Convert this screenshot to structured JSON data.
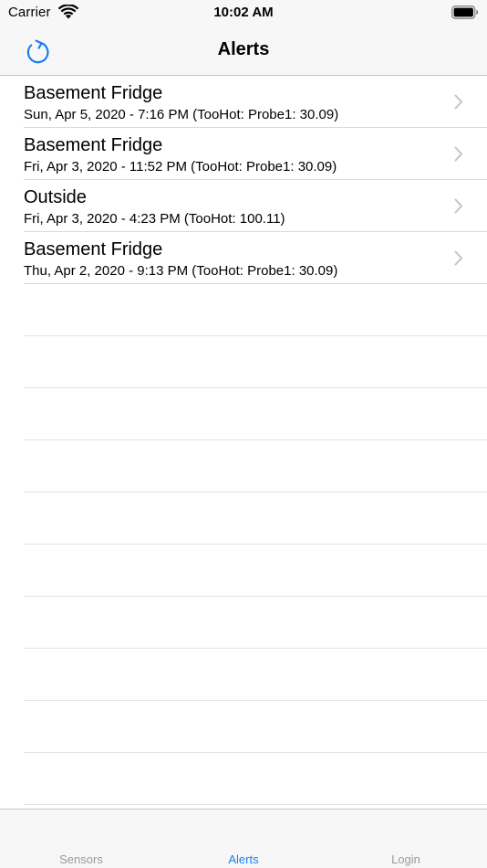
{
  "status_bar": {
    "carrier": "Carrier",
    "time": "10:02 AM",
    "icons": [
      "wifi-icon",
      "battery-icon"
    ]
  },
  "nav_bar": {
    "title": "Alerts",
    "left_icon": "refresh-icon",
    "accent_color": "#1b7ef0"
  },
  "alerts": [
    {
      "title": "Basement Fridge",
      "detail": "Sun, Apr 5, 2020 - 7:16 PM (TooHot: Probe1: 30.09)"
    },
    {
      "title": "Basement Fridge",
      "detail": "Fri, Apr 3, 2020 - 11:52 PM (TooHot: Probe1: 30.09)"
    },
    {
      "title": "Outside",
      "detail": "Fri, Apr 3, 2020 - 4:23 PM (TooHot: 100.11)"
    },
    {
      "title": "Basement Fridge",
      "detail": "Thu, Apr 2, 2020 - 9:13 PM (TooHot: Probe1: 30.09)"
    }
  ],
  "tab_bar": {
    "tabs": [
      {
        "label": "Sensors",
        "active": false
      },
      {
        "label": "Alerts",
        "active": true
      },
      {
        "label": "Login",
        "active": false
      }
    ],
    "active_color": "#1b7ef0",
    "inactive_color": "#9a9a9a"
  }
}
